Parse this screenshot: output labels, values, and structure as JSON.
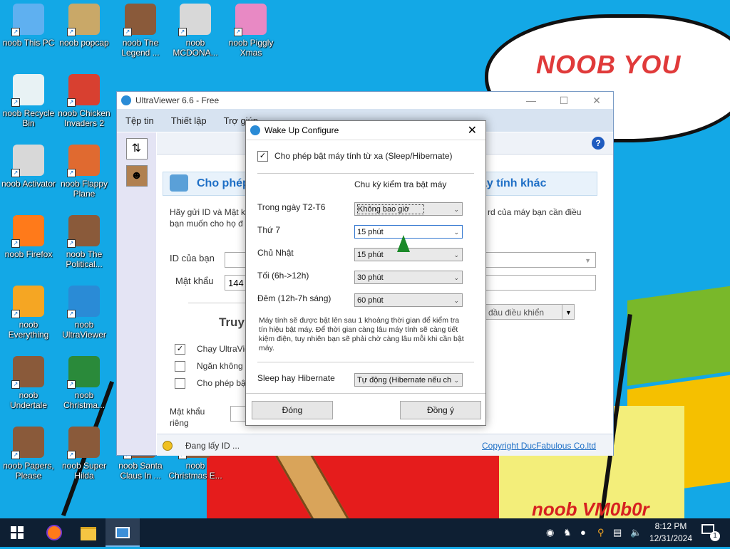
{
  "wallpaper": {
    "bubble_text": "NOOB YOU",
    "signature": "noob VM0b0r"
  },
  "desktop_icons": [
    {
      "label": "noob This PC",
      "icon": "monitor-icon"
    },
    {
      "label": "noob popcap",
      "icon": "folder-icon"
    },
    {
      "label": "noob The Legend ...",
      "icon": "game-icon"
    },
    {
      "label": "noob MCDONA...",
      "icon": "file-icon"
    },
    {
      "label": "noob Piggly Xmas",
      "icon": "pig-icon"
    },
    {
      "label": "noob Recycle Bin",
      "icon": "recycle-bin-icon"
    },
    {
      "label": "noob Chicken Invaders 2",
      "icon": "chicken-icon"
    },
    {
      "label": "noob Activator",
      "icon": "file-icon"
    },
    {
      "label": "noob Flappy Plane",
      "icon": "plane-icon"
    },
    {
      "label": "noob Firefox",
      "icon": "firefox-icon"
    },
    {
      "label": "noob The Political...",
      "icon": "game-icon"
    },
    {
      "label": "noob Everything",
      "icon": "search-icon"
    },
    {
      "label": "noob UltraViewer",
      "icon": "ultraviewer-icon"
    },
    {
      "label": "noob Undertale",
      "icon": "game-icon"
    },
    {
      "label": "noob Christma...",
      "icon": "tree-icon"
    },
    {
      "label": "noob Papers, Please",
      "icon": "game-icon"
    },
    {
      "label": "noob Super Hilda",
      "icon": "game-icon"
    },
    {
      "label": "noob Santa Claus In ...",
      "icon": "game-icon"
    },
    {
      "label": "noob Christmas E...",
      "icon": "game-icon"
    }
  ],
  "ultraviewer": {
    "title": "UltraViewer 6.6 - Free",
    "menu": [
      "Tệp tin",
      "Thiết lập",
      "Trợ giúp"
    ],
    "banner_left": "Cho phép",
    "banner_right": "áy tính khác",
    "desc_left_1": "Hãy gửi ID và Mật kh",
    "desc_left_2": "bạn muốn cho họ đ",
    "desc_right": "rd của máy bạn cần điều",
    "id_label": "ID của bạn",
    "password_label": "Mật khẩu",
    "password_value": "144",
    "remote_title": "Truy",
    "control_select": "đầu điều khiển",
    "opt1": "Chạy UltraVie",
    "opt2": "Ngăn không",
    "opt3": "Cho phép bậ",
    "private_pw_label_1": "Mật khẩu",
    "private_pw_label_2": "riêng",
    "status_text": "Đang lấy ID ...",
    "copyright": "Copyright DucFabulous Co.ltd"
  },
  "dialog": {
    "title": "Wake Up Configure",
    "enable_label": "Cho phép bật máy tính từ xa (Sleep/Hibernate)",
    "column_header": "Chu kỳ kiểm tra bật máy",
    "rows": [
      {
        "label": "Trong ngày T2-T6",
        "value": "Không bao giờ"
      },
      {
        "label": "Thứ 7",
        "value": "15 phút"
      },
      {
        "label": "Chủ Nhật",
        "value": "15 phút"
      },
      {
        "label": "Tối (6h->12h)",
        "value": "30 phút"
      },
      {
        "label": "Đêm (12h-7h sáng)",
        "value": "60 phút"
      }
    ],
    "note": "Máy tính sẽ được bật lên sau 1 khoảng thời gian để kiểm tra tín hiệu bật máy. Để thời gian càng lâu máy tính sẽ càng tiết kiệm điện, tuy nhiên bạn sẽ phải chờ càng lâu mỗi khi cần bật máy.",
    "sleep_label": "Sleep hay Hibernate",
    "sleep_value": "Tự động (Hibernate nếu ch",
    "close_button": "Đóng",
    "ok_button": "Đồng ý"
  },
  "taskbar": {
    "time": "8:12 PM",
    "date": "12/31/2024",
    "notification_count": "1"
  }
}
